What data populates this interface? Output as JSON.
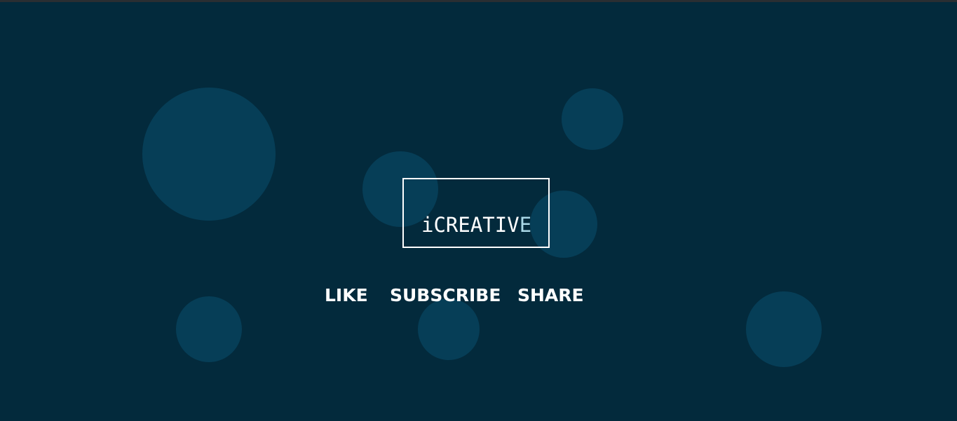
{
  "logo": {
    "text_main": "iCREATIV",
    "text_tail": "E"
  },
  "nav": {
    "like_label": "LIKE",
    "subscribe_label": "SUBSCRIBE",
    "share_label": "SHARE"
  },
  "colors": {
    "background": "#032a3c",
    "bubble": "#063e57",
    "text": "#ffffff",
    "accent": "#a9d7e6"
  }
}
